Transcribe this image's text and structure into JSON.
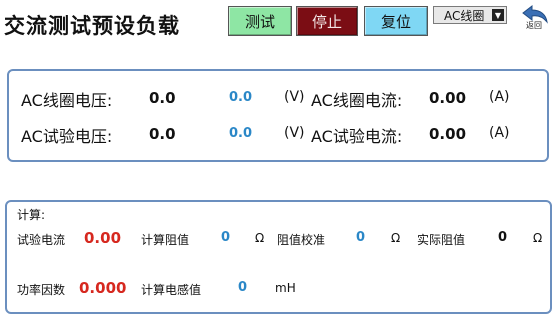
{
  "title": "交流测试预设负载",
  "buttons": {
    "test": "测试",
    "stop": "停止",
    "reset": "复位"
  },
  "mode_select": {
    "value": "AC线圈"
  },
  "back": {
    "label": "返回"
  },
  "colors": {
    "test_btn": "#8ee6a4",
    "stop_btn": "#7b0d14",
    "reset_btn": "#7fd7f4",
    "panel_border": "#6b8fbf",
    "red_value": "#d6281f",
    "blue_value": "#2a87c7"
  },
  "readings": {
    "coil_voltage": {
      "label": "AC线圈电压:",
      "value": "0.0",
      "set": "0.0",
      "unit": "(V)"
    },
    "coil_current": {
      "label": "AC线圈电流:",
      "value": "0.00",
      "unit": "(A)"
    },
    "test_voltage": {
      "label": "AC试验电压:",
      "value": "0.0",
      "set": "0.0",
      "unit": "(V)"
    },
    "test_current": {
      "label": "AC试验电流:",
      "value": "0.00",
      "unit": "(A)"
    }
  },
  "calc": {
    "heading": "计算:",
    "test_current": {
      "label": "试验电流",
      "value": "0.00"
    },
    "calc_resistance": {
      "label": "计算阻值",
      "value": "0",
      "unit": "Ω"
    },
    "resistance_calib": {
      "label": "阻值校准",
      "value": "0",
      "unit": "Ω"
    },
    "actual_resistance": {
      "label": "实际阻值",
      "value": "0",
      "unit": "Ω"
    },
    "power_factor": {
      "label": "功率因数",
      "value": "0.000"
    },
    "calc_inductance": {
      "label": "计算电感值",
      "value": "0",
      "unit": "mH"
    }
  }
}
